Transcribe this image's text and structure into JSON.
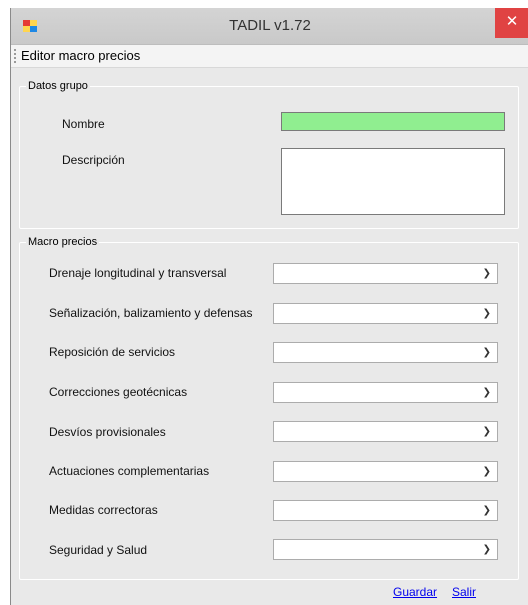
{
  "window": {
    "title": "TADIL v1.72",
    "close_label": "✕"
  },
  "menu": {
    "items": [
      "Editor macro precios"
    ]
  },
  "datos_grupo": {
    "legend": "Datos grupo",
    "nombre_label": "Nombre",
    "descripcion_label": "Descripción",
    "nombre_value": "",
    "descripcion_value": "",
    "nombre_color": "#90ee90"
  },
  "macro_precios": {
    "legend": "Macro precios",
    "rows": [
      {
        "label": "Drenaje longitudinal y transversal",
        "value": ""
      },
      {
        "label": "Señalización, balizamiento y defensas",
        "value": ""
      },
      {
        "label": "Reposición de servicios",
        "value": ""
      },
      {
        "label": "Correcciones geotécnicas",
        "value": ""
      },
      {
        "label": "Desvíos provisionales",
        "value": ""
      },
      {
        "label": "Actuaciones complementarias",
        "value": ""
      },
      {
        "label": "Medidas correctoras",
        "value": ""
      },
      {
        "label": "Seguridad y Salud",
        "value": ""
      }
    ]
  },
  "actions": {
    "guardar": "Guardar",
    "salir": "Salir"
  },
  "icons": {
    "dropdown": "chevron-down-icon",
    "app": "app-icon"
  }
}
